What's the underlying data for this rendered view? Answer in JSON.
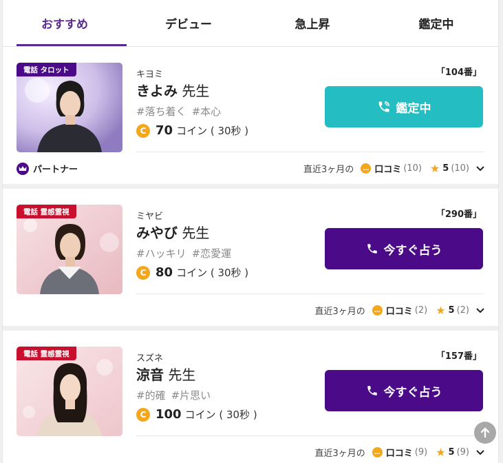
{
  "tabs": [
    {
      "label": "おすすめ",
      "active": true
    },
    {
      "label": "デビュー",
      "active": false
    },
    {
      "label": "急上昇",
      "active": false
    },
    {
      "label": "鑑定中",
      "active": false
    }
  ],
  "cards": [
    {
      "category": "電話 タロット",
      "kana": "キヨミ",
      "name": "きよみ",
      "honorific": "先生",
      "tags": [
        "#落ち着く",
        "#本心"
      ],
      "price": "70",
      "price_unit": "コイン ( 30秒 )",
      "rank": "「104番」",
      "button_label": "鑑定中",
      "button_state": "busy",
      "partner_label": "パートナー",
      "period_label": "直近3ヶ月の",
      "review_label": "口コミ",
      "review_count": "(10)",
      "rating": "5",
      "rating_count": "(10)"
    },
    {
      "category": "電話 霊感霊視",
      "kana": "ミヤビ",
      "name": "みやび",
      "honorific": "先生",
      "tags": [
        "#ハッキリ",
        "#恋愛運"
      ],
      "price": "80",
      "price_unit": "コイン ( 30秒 )",
      "rank": "「290番」",
      "button_label": "今すぐ占う",
      "button_state": "available",
      "period_label": "直近3ヶ月の",
      "review_label": "口コミ",
      "review_count": "(2)",
      "rating": "5",
      "rating_count": "(2)"
    },
    {
      "category": "電話 霊感霊視",
      "kana": "スズネ",
      "name": "涼音",
      "honorific": "先生",
      "tags": [
        "#的確",
        "#片思い"
      ],
      "price": "100",
      "price_unit": "コイン ( 30秒 )",
      "rank": "「157番」",
      "button_label": "今すぐ占う",
      "button_state": "available",
      "period_label": "直近3ヶ月の",
      "review_label": "口コミ",
      "review_count": "(9)",
      "rating": "5",
      "rating_count": "(9)"
    }
  ],
  "coin_symbol": "C",
  "review_symbol": "…",
  "colors": {
    "brand_purple": "#4b0a87",
    "tab_active": "#5a2b8f",
    "busy_teal": "#24bdc2",
    "coin_gold": "#f3a71c",
    "category_red": "#c8102e"
  },
  "icons": [
    "phone-busy-icon",
    "phone-icon",
    "crown-icon",
    "coin-icon",
    "chat-bubble-icon",
    "star-icon",
    "chevron-down-icon",
    "arrow-up-icon"
  ]
}
